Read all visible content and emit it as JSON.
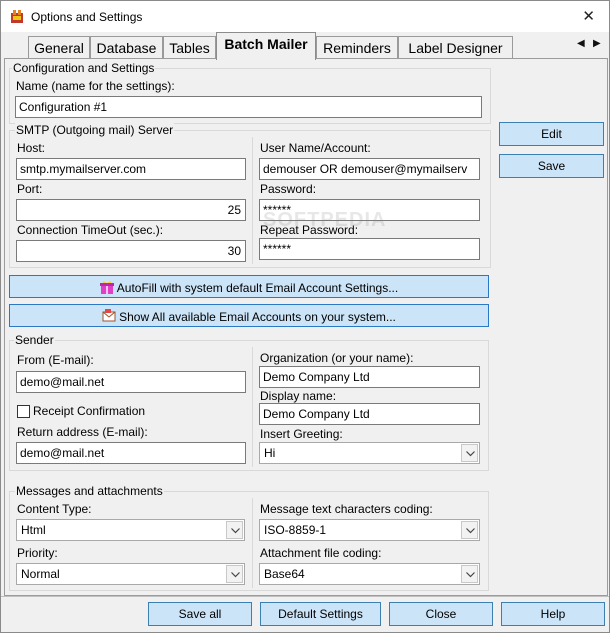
{
  "window": {
    "title": "Options and Settings",
    "close_glyph": "✕"
  },
  "tabs": [
    {
      "label": "General"
    },
    {
      "label": "Database"
    },
    {
      "label": "Tables"
    },
    {
      "label": "Batch Mailer"
    },
    {
      "label": "Reminders"
    },
    {
      "label": "Label Designer"
    }
  ],
  "tab_scroll": {
    "left": "◀",
    "right": "▶"
  },
  "config": {
    "group_title": "Configuration and Settings",
    "name_label": "Name (name for the settings):",
    "name_value": "Configuration #1"
  },
  "side_buttons": {
    "edit": "Edit",
    "save": "Save"
  },
  "smtp": {
    "group_title": "SMTP (Outgoing mail) Server",
    "host_label": "Host:",
    "host_value": "smtp.mymailserver.com",
    "port_label": "Port:",
    "port_value": "25",
    "timeout_label": "Connection TimeOut (sec.):",
    "timeout_value": "30",
    "user_label": "User Name/Account:",
    "user_value": "demouser OR demouser@mymailserv",
    "password_label": "Password:",
    "password_value": "******",
    "repeat_password_label": "Repeat Password:",
    "repeat_password_value": "******"
  },
  "autofill_button": "AutoFill with system default Email Account Settings...",
  "show_accounts_button": "Show All available Email Accounts on your system...",
  "sender": {
    "group_title": "Sender",
    "from_label": "From (E-mail):",
    "from_value": "demo@mail.net",
    "receipt_label": "Receipt Confirmation",
    "return_label": "Return address (E-mail):",
    "return_value": "demo@mail.net",
    "org_label": "Organization (or your name):",
    "org_value": "Demo Company Ltd",
    "display_label": "Display name:",
    "display_value": "Demo Company Ltd",
    "greeting_label": "Insert Greeting:",
    "greeting_value": "Hi"
  },
  "messages": {
    "group_title": "Messages and attachments",
    "content_type_label": "Content Type:",
    "content_type_value": "Html",
    "priority_label": "Priority:",
    "priority_value": "Normal",
    "coding_label": "Message text characters coding:",
    "coding_value": "ISO-8859-1",
    "attach_coding_label": "Attachment file coding:",
    "attach_coding_value": "Base64"
  },
  "bottom_buttons": {
    "save_all": "Save all",
    "default_settings": "Default Settings",
    "close": "Close",
    "help": "Help"
  },
  "watermark": "SOFTPEDIA",
  "colors": {
    "button_fill": "#cce4f7",
    "button_border": "#3c7fb1",
    "window_bg": "#f0f0f0"
  }
}
